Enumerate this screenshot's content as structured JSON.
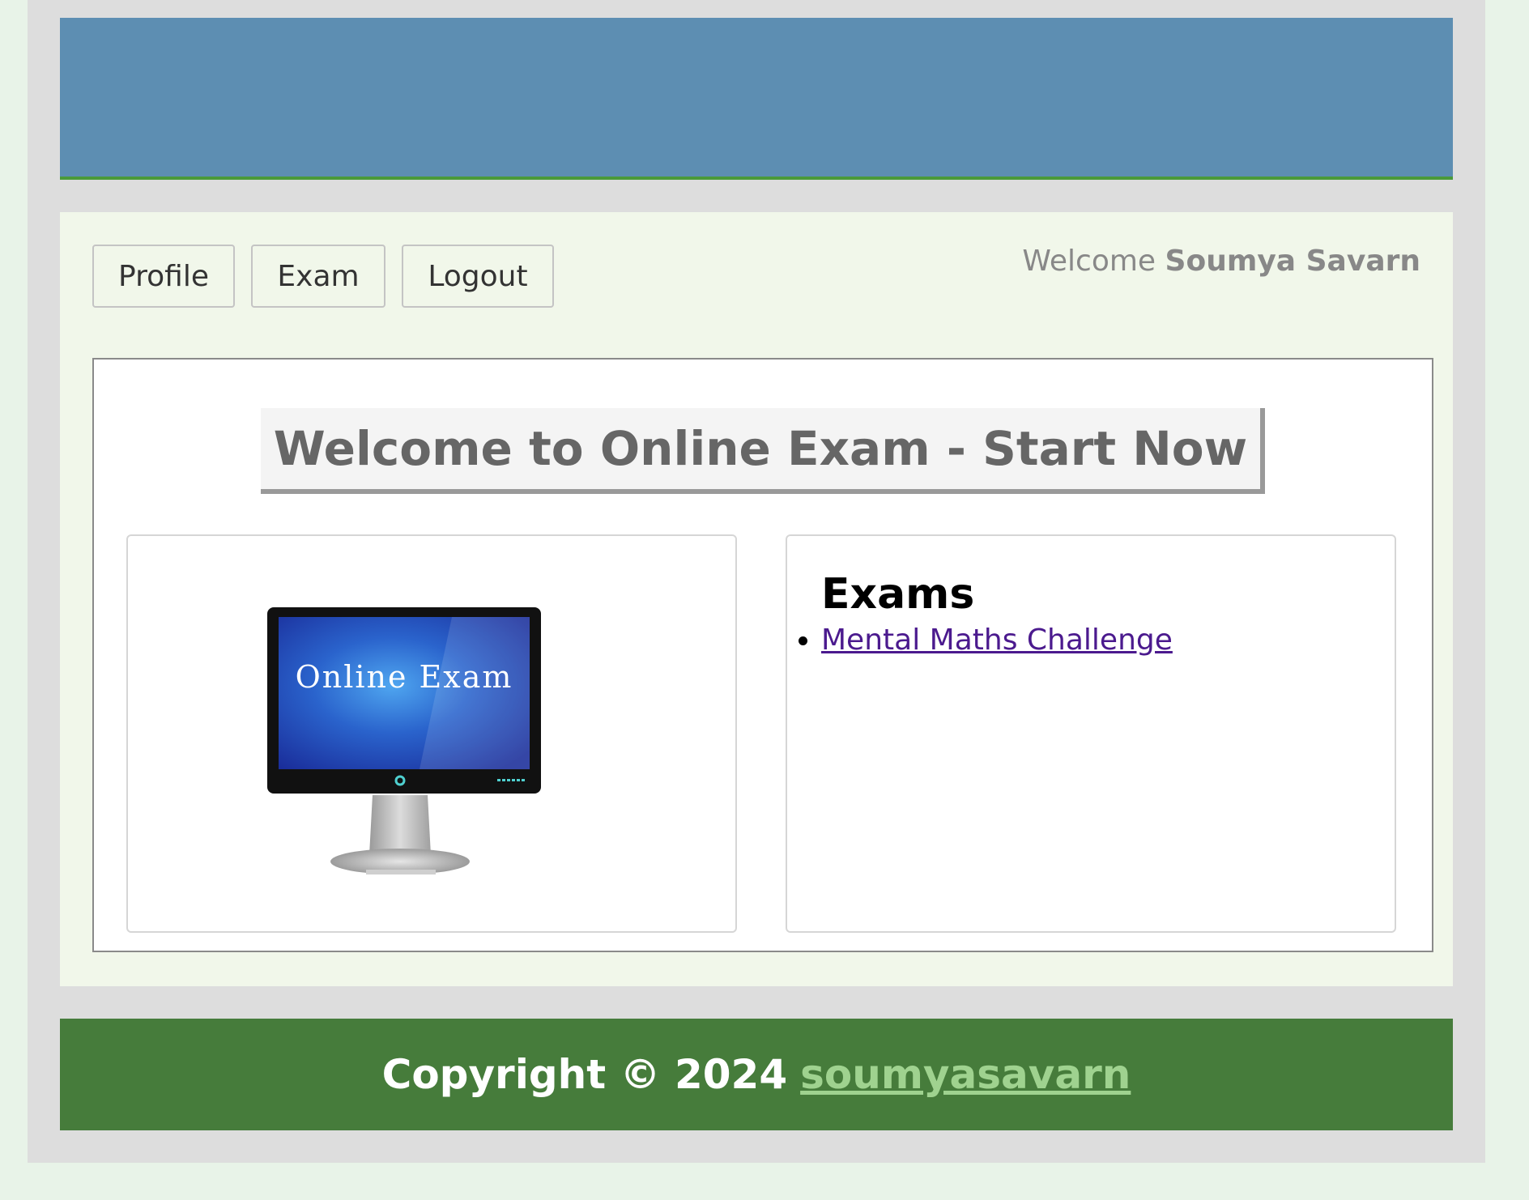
{
  "nav": {
    "profile_label": "Profile",
    "exam_label": "Exam",
    "logout_label": "Logout"
  },
  "user": {
    "welcome_prefix": "Welcome",
    "name": "Soumya Savarn"
  },
  "main": {
    "banner_title": "Welcome to Online Exam - Start Now",
    "image_text": "Online Exam",
    "exams_heading": "Exams",
    "exams": [
      {
        "label": "Mental Maths Challenge"
      }
    ]
  },
  "footer": {
    "copyright": "Copyright © 2024",
    "link_label": "soumyasavarn"
  },
  "colors": {
    "header": "#5d8eb2",
    "footer": "#467c3b",
    "link": "#4b1a8e",
    "footer_link": "#9fd28f"
  }
}
